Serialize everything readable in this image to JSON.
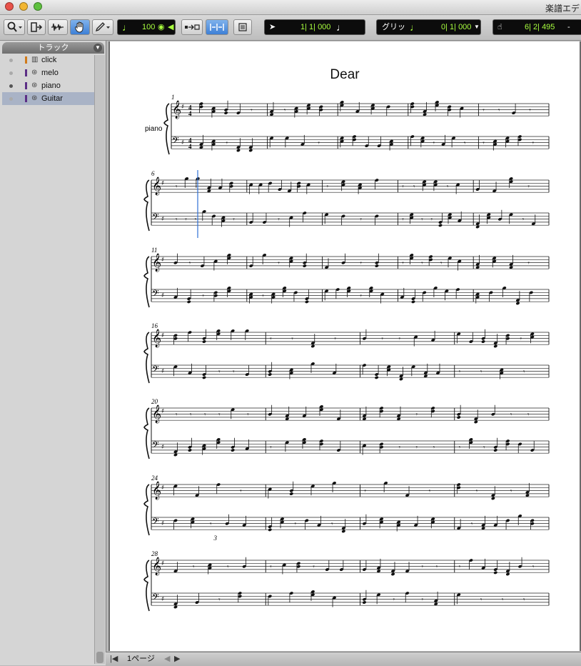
{
  "window": {
    "title": "楽譜エデ"
  },
  "toolbar": {
    "tempo_value": "100",
    "main_counter": "1| 1| 000",
    "grid_label": "グリッ",
    "grid_value": "0| 1| 000",
    "cursor_position": "6| 2| 495",
    "cursor_suffix": "-"
  },
  "sidebar": {
    "header": "トラック",
    "tracks": [
      {
        "name": "click",
        "type": "click",
        "color": "#d07a1a",
        "selected": false
      },
      {
        "name": "melo",
        "type": "instrument",
        "color": "#5c2f86",
        "selected": false
      },
      {
        "name": "piano",
        "type": "instrument",
        "color": "#5c2f86",
        "selected": false
      },
      {
        "name": "Guitar",
        "type": "instrument",
        "color": "#5c2f86",
        "selected": true
      }
    ]
  },
  "score": {
    "title": "Dear",
    "instrument_label": "piano",
    "systems": [
      {
        "start_measure": "1",
        "measures": 5
      },
      {
        "start_measure": "6",
        "measures": 5
      },
      {
        "start_measure": "11",
        "measures": 5
      },
      {
        "start_measure": "16",
        "measures": 4
      },
      {
        "start_measure": "20",
        "measures": 4
      },
      {
        "start_measure": "24",
        "measures": 4
      },
      {
        "start_measure": "28",
        "measures": 4
      }
    ],
    "triplet_label": "3"
  },
  "statusbar": {
    "page_label": "1ページ"
  },
  "colors": {
    "playhead": "#2f6fd6",
    "lcd_text": "#a8ff3e",
    "selected_track": "#a9b3c6"
  }
}
